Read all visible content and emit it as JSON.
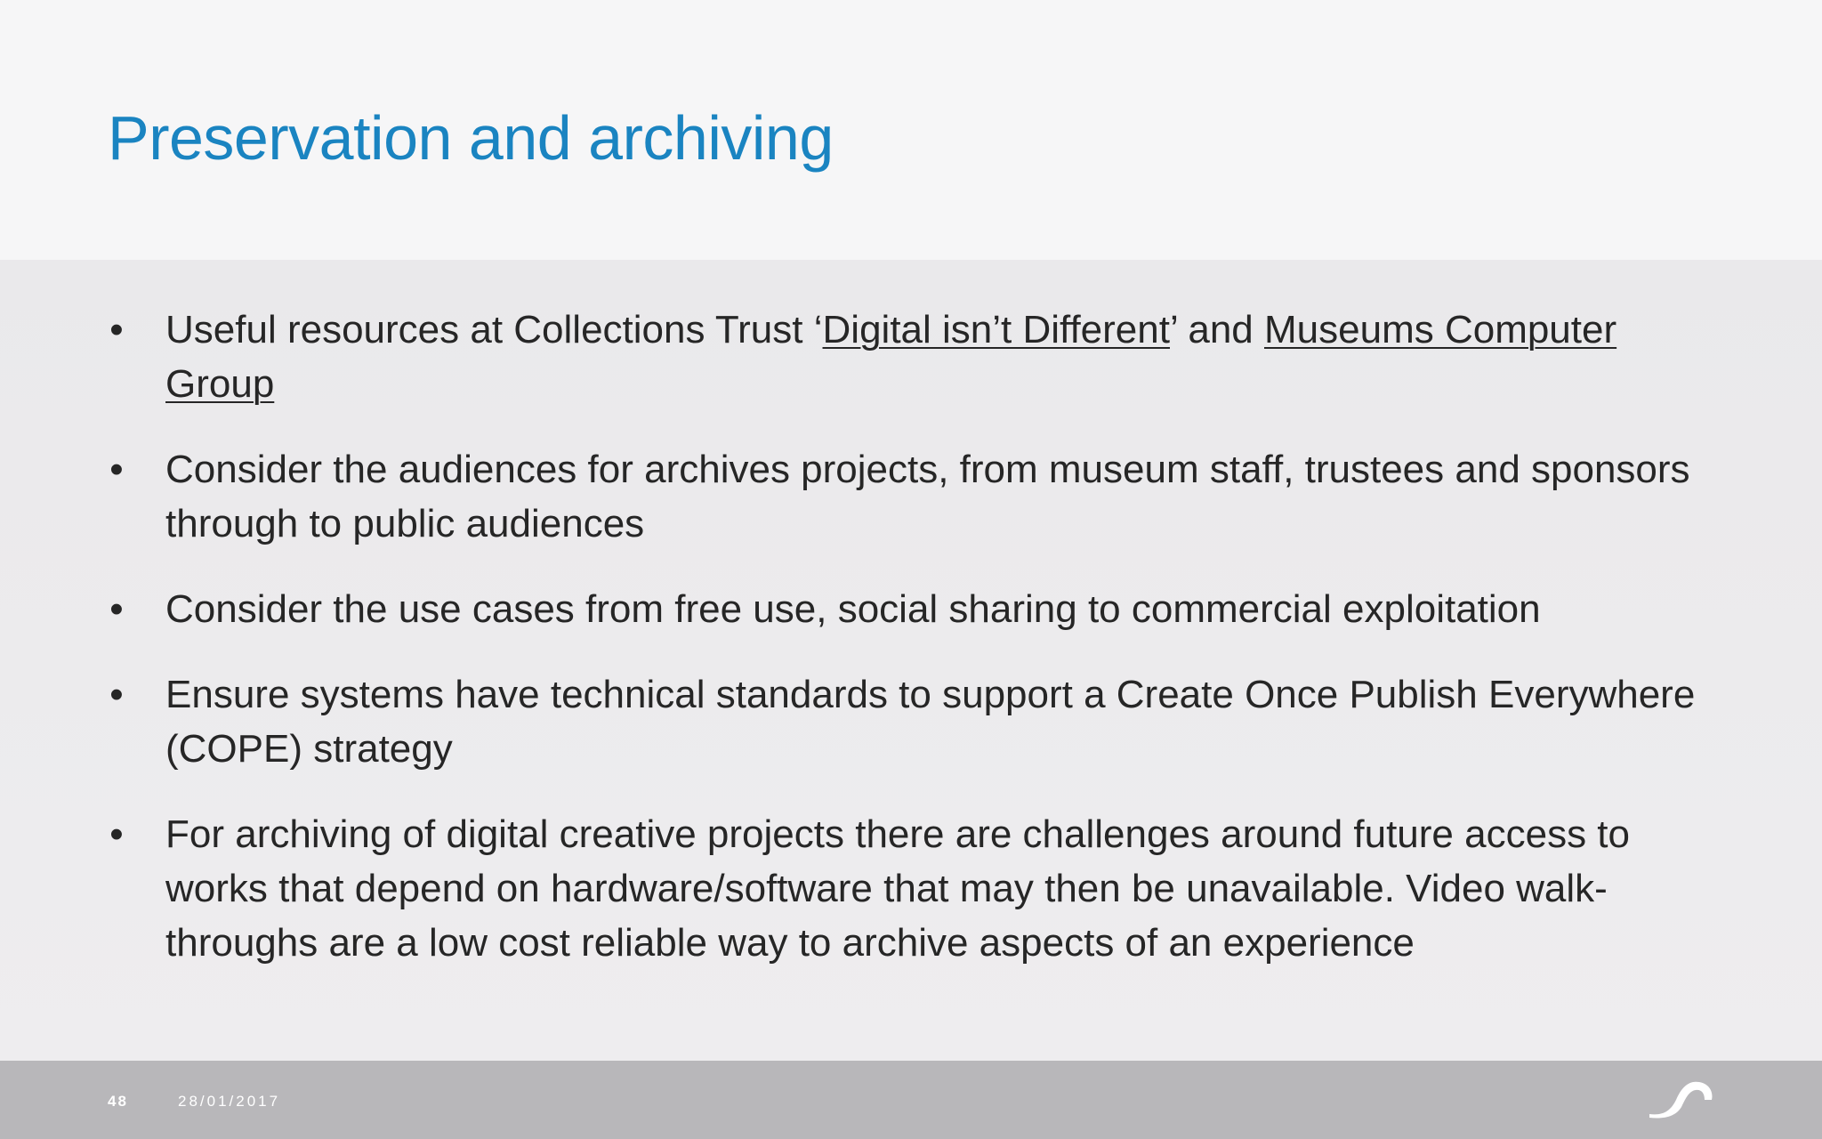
{
  "slide": {
    "title": "Preservation and archiving"
  },
  "bullets": [
    {
      "parts": [
        {
          "text": "Useful resources at Collections Trust ‘",
          "link": false
        },
        {
          "text": "Digital isn’t Different",
          "link": true
        },
        {
          "text": "’ and ",
          "link": false
        },
        {
          "text": "Museums Computer Group",
          "link": true
        }
      ]
    },
    {
      "text": "Consider the audiences for archives projects, from museum staff, trustees and sponsors through to public audiences"
    },
    {
      "text": "Consider the use cases from free use, social sharing to commercial exploitation"
    },
    {
      "text": "Ensure systems have technical standards to support a Create Once Publish Everywhere (COPE) strategy"
    },
    {
      "text": "For archiving of digital creative projects there are challenges around future access to works that depend on hardware/software that may then be unavailable. Video walk-throughs are a low cost reliable way to archive aspects of an experience"
    }
  ],
  "bullet_glyph": "•",
  "footer": {
    "page_number": "48",
    "date": "28/01/2017",
    "logo_icon": "wave-logo-icon"
  },
  "colors": {
    "title": "#1a84c1",
    "footer_bg": "#b8b7ba"
  }
}
